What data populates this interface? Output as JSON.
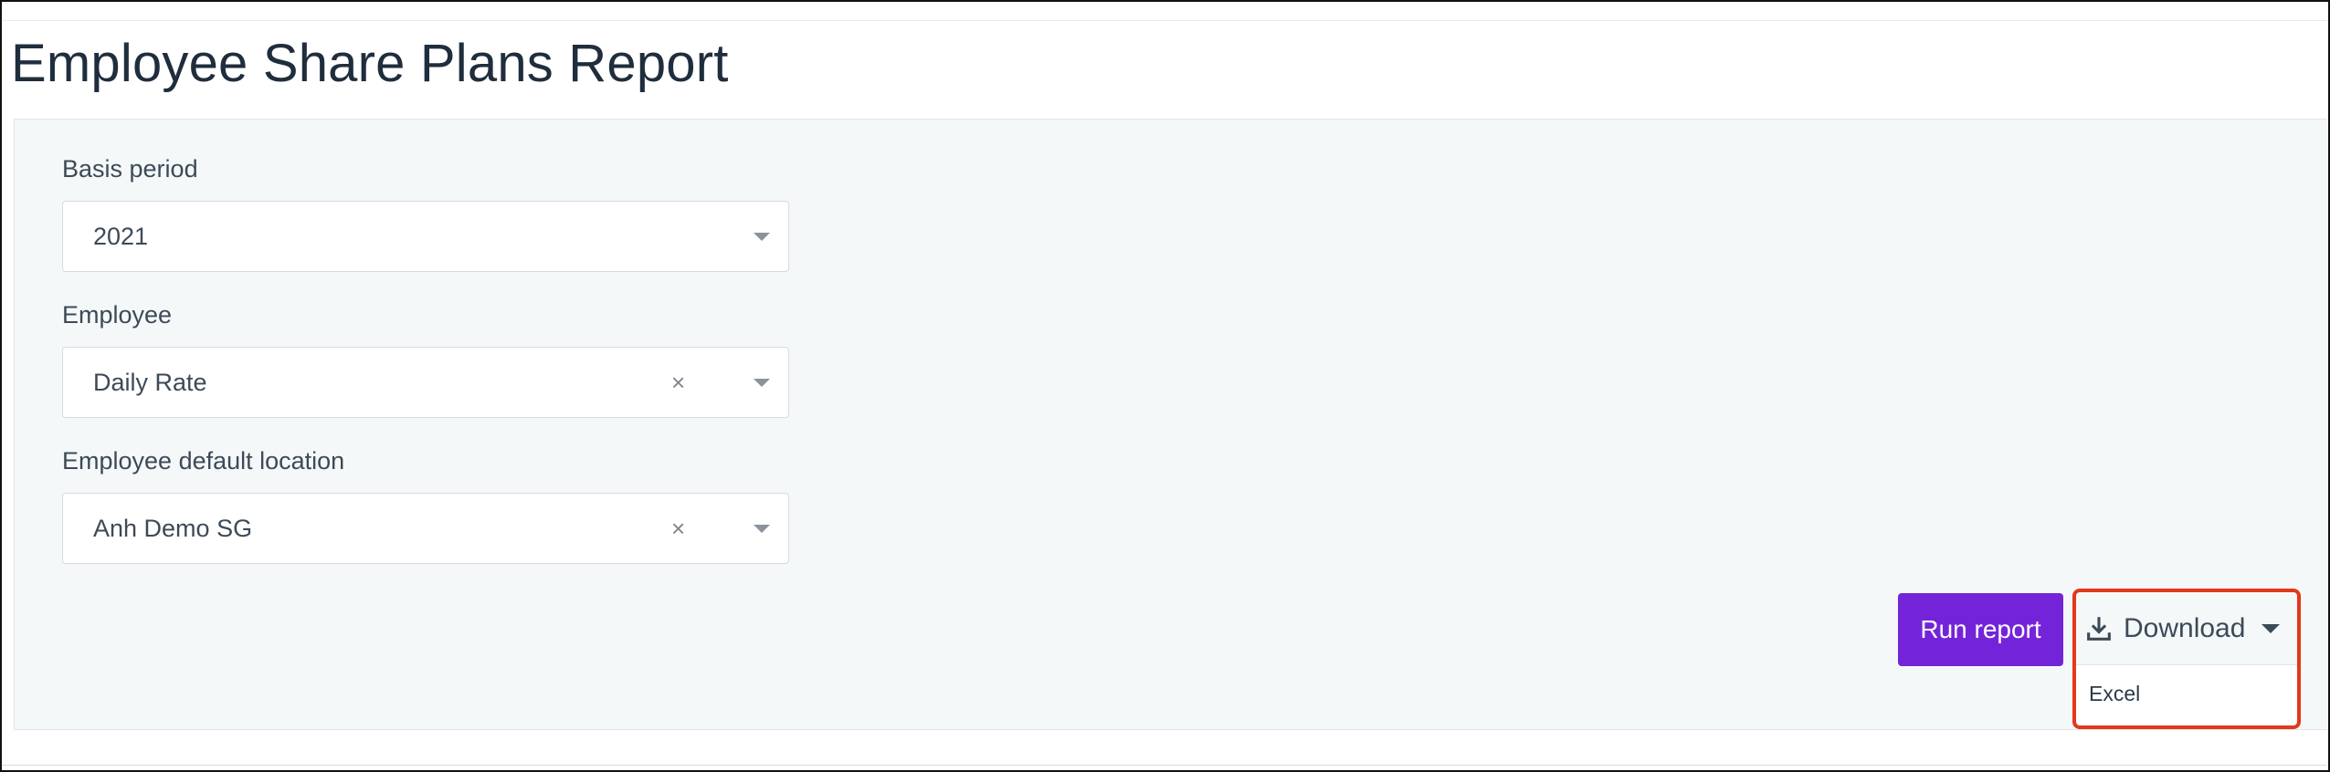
{
  "page": {
    "title": "Employee Share Plans Report"
  },
  "filters": {
    "basis_period": {
      "label": "Basis period",
      "value": "2021"
    },
    "employee": {
      "label": "Employee",
      "value": "Daily Rate",
      "clear": "×"
    },
    "location": {
      "label": "Employee default location",
      "value": "Anh Demo SG",
      "clear": "×"
    }
  },
  "actions": {
    "run_report": "Run report",
    "download": "Download",
    "download_menu": [
      "Excel"
    ]
  },
  "colors": {
    "accent": "#7424d8",
    "highlight": "#e3381b"
  },
  "icons": {
    "dropdown": "chevron-down-icon",
    "clear": "close-icon",
    "download": "download-icon"
  }
}
